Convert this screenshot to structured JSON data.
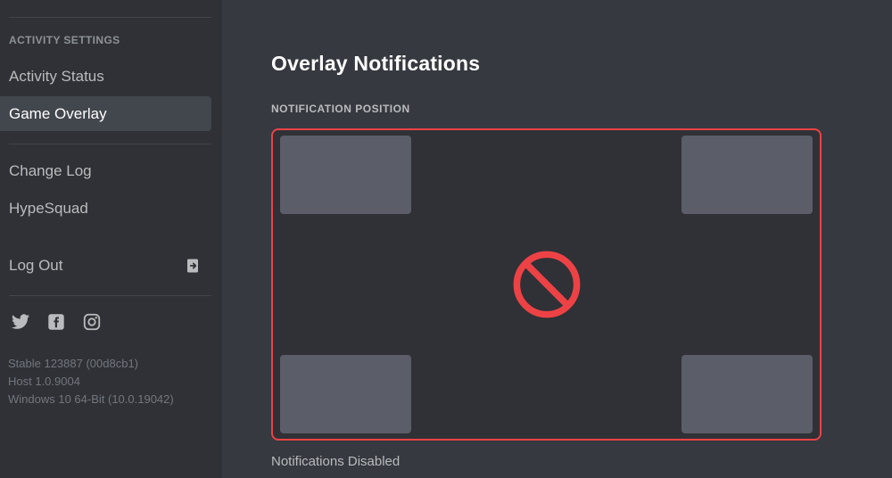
{
  "sidebar": {
    "section_header": "ACTIVITY SETTINGS",
    "items": [
      {
        "label": "Activity Status",
        "active": false,
        "icon": ""
      },
      {
        "label": "Game Overlay",
        "active": true,
        "icon": ""
      },
      {
        "label": "Change Log",
        "active": false,
        "icon": ""
      },
      {
        "label": "HypeSquad",
        "active": false,
        "icon": ""
      }
    ],
    "logout": {
      "label": "Log Out",
      "icon": "logout-arrow-icon"
    },
    "socials": [
      {
        "name": "twitter-icon",
        "label": "Twitter"
      },
      {
        "name": "facebook-icon",
        "label": "Facebook"
      },
      {
        "name": "instagram-icon",
        "label": "Instagram"
      }
    ],
    "version": {
      "build": "Stable 123887 (00d8cb1)",
      "host": "Host 1.0.9004",
      "os": "Windows 10 64-Bit (10.0.19042)"
    }
  },
  "main": {
    "title": "Overlay Notifications",
    "subsection_label": "NOTIFICATION POSITION",
    "picker": {
      "selected": "disabled",
      "center_icon": "no-entry-icon",
      "corners": [
        {
          "name": "top-left",
          "label": ""
        },
        {
          "name": "top-right",
          "label": ""
        },
        {
          "name": "bottom-left",
          "label": ""
        },
        {
          "name": "bottom-right",
          "label": ""
        }
      ]
    },
    "status_text": "Notifications Disabled"
  },
  "colors": {
    "accent_red": "#ed4245",
    "sidebar_bg": "#2f3136",
    "main_bg": "#36393f",
    "box_grey": "#5b5e68",
    "text_muted": "#b9bbbe",
    "text_dim": "#72767d",
    "active_bg": "#42464d"
  }
}
